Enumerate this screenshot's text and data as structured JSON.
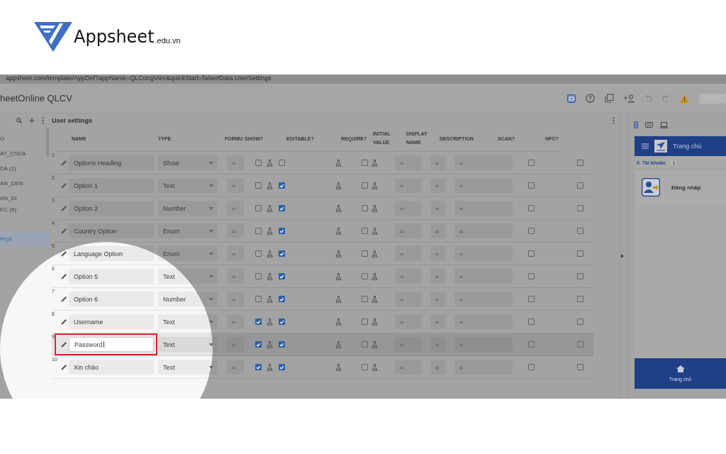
{
  "brand": {
    "name": "Appsheet",
    "suffix": ".edu.vn"
  },
  "browser": {
    "url": "appsheet.com/template/AppDef?appName=QLCongViec&quickStart=false#Data.UserSettings"
  },
  "app": {
    "title": "heetOnline QLCV"
  },
  "sidebar": {
    "items": [
      {
        "label": "O",
        "selected": false
      },
      {
        "label": "AT_CSDA",
        "selected": false
      },
      {
        "label": "DA (1)",
        "selected": false
      },
      {
        "label": "AN_DEN",
        "selected": false
      },
      {
        "label": "AN_DI",
        "selected": false
      },
      {
        "label": "EC (6)",
        "selected": false
      },
      {
        "label": "tings",
        "selected": true
      }
    ]
  },
  "table": {
    "title": "User settings",
    "columns": [
      {
        "label": "NAME"
      },
      {
        "label": "TYPE"
      },
      {
        "label": "FORMU"
      },
      {
        "label": "SHOW?"
      },
      {
        "label": "EDITABLE?"
      },
      {
        "label": "REQUIRE?"
      },
      {
        "label": "INITIAL VALUE"
      },
      {
        "label": "DISPLAY NAME"
      },
      {
        "label": "DESCRIPTION"
      },
      {
        "label": "SCAN?"
      },
      {
        "label": "NFC?"
      }
    ],
    "rows": [
      {
        "number": "1",
        "name": "Options Heading",
        "type": "Show",
        "formula": "=",
        "show": false,
        "editable": false,
        "require": false,
        "initial_value": "=",
        "display_name": "=",
        "description": "=",
        "scan": false,
        "nfc": false,
        "selected": false
      },
      {
        "number": "2",
        "name": "Option 1",
        "type": "Text",
        "formula": "=",
        "show": false,
        "editable": true,
        "require": false,
        "initial_value": "=",
        "display_name": "=",
        "description": "=",
        "scan": false,
        "nfc": false,
        "selected": false
      },
      {
        "number": "3",
        "name": "Option 2",
        "type": "Number",
        "formula": "=",
        "show": false,
        "editable": true,
        "require": false,
        "initial_value": "=",
        "display_name": "=",
        "description": "=",
        "scan": false,
        "nfc": false,
        "selected": false
      },
      {
        "number": "4",
        "name": "Country Option",
        "type": "Enum",
        "formula": "=",
        "show": false,
        "editable": true,
        "require": false,
        "initial_value": "=",
        "display_name": "=",
        "description": "=",
        "scan": false,
        "nfc": false,
        "selected": false
      },
      {
        "number": "5",
        "name": "Language Option",
        "type": "Enum",
        "formula": "=",
        "show": false,
        "editable": true,
        "require": false,
        "initial_value": "=",
        "display_name": "=",
        "description": "=",
        "scan": false,
        "nfc": false,
        "selected": false
      },
      {
        "number": "6",
        "name": "Option 5",
        "type": "Text",
        "formula": "=",
        "show": false,
        "editable": true,
        "require": false,
        "initial_value": "=",
        "display_name": "=",
        "description": "=",
        "scan": false,
        "nfc": false,
        "selected": false
      },
      {
        "number": "7",
        "name": "Option 6",
        "type": "Number",
        "formula": "=",
        "show": false,
        "editable": true,
        "require": false,
        "initial_value": "=",
        "display_name": "=",
        "description": "=",
        "scan": false,
        "nfc": false,
        "selected": false
      },
      {
        "number": "8",
        "name": "Username",
        "type": "Text",
        "formula": "=",
        "show": true,
        "editable": true,
        "require": false,
        "initial_value": "=",
        "display_name": "=",
        "description": "=",
        "scan": false,
        "nfc": false,
        "selected": false
      },
      {
        "number": "9",
        "name": "Password",
        "type": "Text",
        "formula": "=",
        "show": true,
        "editable": true,
        "require": false,
        "initial_value": "=",
        "display_name": "=",
        "description": "=",
        "scan": false,
        "nfc": false,
        "selected": true
      },
      {
        "number": "10",
        "name": "Xin chào",
        "type": "Text",
        "formula": "=",
        "show": true,
        "editable": true,
        "require": false,
        "initial_value": "=",
        "display_name": "=",
        "description": "=",
        "scan": false,
        "nfc": false,
        "selected": false
      }
    ]
  },
  "preview": {
    "devices": [
      {
        "kind": "phone",
        "selected": true
      },
      {
        "kind": "tablet",
        "selected": false
      },
      {
        "kind": "desktop",
        "selected": false
      }
    ],
    "header_title": "Trang chủ",
    "section": {
      "label": "0. Tài khoản",
      "count": "1"
    },
    "card": {
      "label": "Đăng nhập"
    },
    "nav": {
      "label": "Trang chủ"
    }
  }
}
